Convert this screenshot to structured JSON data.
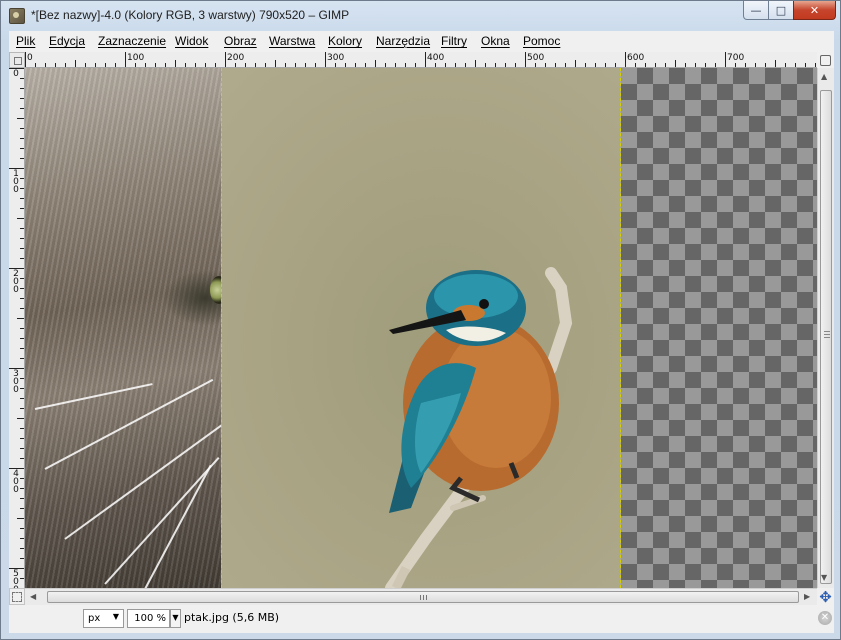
{
  "window": {
    "title": "*[Bez nazwy]-4.0 (Kolory RGB, 3 warstwy) 790x520 – GIMP",
    "minimize_icon": "minimize-icon",
    "maximize_icon": "maximize-icon",
    "close_icon": "close-icon"
  },
  "menu": [
    {
      "label": "Plik"
    },
    {
      "label": "Edycja"
    },
    {
      "label": "Zaznaczenie"
    },
    {
      "label": "Widok"
    },
    {
      "label": "Obraz"
    },
    {
      "label": "Warstwa"
    },
    {
      "label": "Kolory"
    },
    {
      "label": "Narzędzia"
    },
    {
      "label": "Filtry"
    },
    {
      "label": "Okna"
    },
    {
      "label": "Pomoc"
    }
  ],
  "ruler": {
    "horizontal_labels": [
      "0",
      "100",
      "200",
      "300",
      "400",
      "500",
      "600",
      "700"
    ],
    "vertical_labels": [
      "0",
      "100",
      "200",
      "300",
      "400",
      "500"
    ]
  },
  "canvas": {
    "layer_boundary_color": "#d6d000",
    "layers": [
      "cat",
      "kingfisher",
      "transparent"
    ]
  },
  "status": {
    "unit": "px",
    "zoom": "100 %",
    "message": "ptak.jpg (5,6 MB)"
  }
}
